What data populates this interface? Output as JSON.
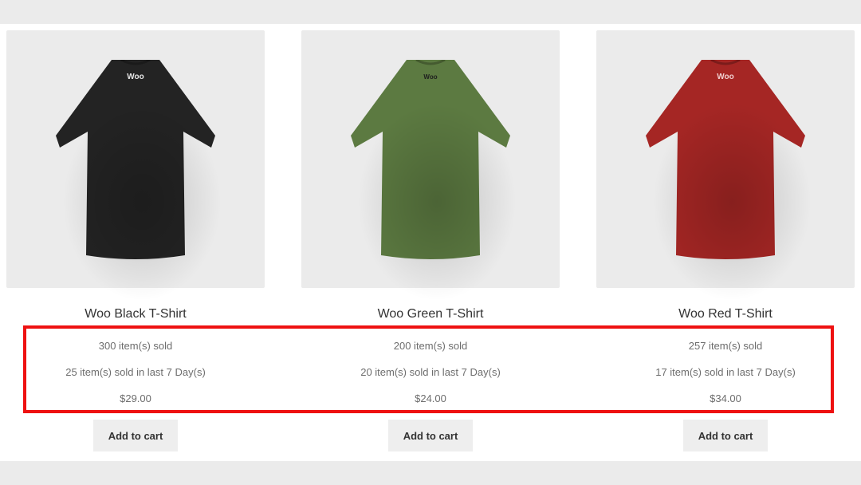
{
  "products": [
    {
      "title": "Woo Black T-Shirt",
      "sold_total": "300 item(s) sold",
      "sold_recent": "25 item(s) sold in last 7 Day(s)",
      "price": "$29.00",
      "cart_label": "Add to cart",
      "shirt_color": "#232323",
      "logo_text": "Woo"
    },
    {
      "title": "Woo Green T-Shirt",
      "sold_total": "200 item(s) sold",
      "sold_recent": "20 item(s) sold in last 7 Day(s)",
      "price": "$24.00",
      "cart_label": "Add to cart",
      "shirt_color": "#5c7a41",
      "logo_text": "Woo"
    },
    {
      "title": "Woo Red T-Shirt",
      "sold_total": "257 item(s) sold",
      "sold_recent": "17 item(s) sold in last 7 Day(s)",
      "price": "$34.00",
      "cart_label": "Add to cart",
      "shirt_color": "#a52624",
      "logo_text": "Woo"
    }
  ],
  "colors": {
    "highlight": "#ee1111",
    "page_bg": "#ebebeb",
    "card_bg": "#ebebeb",
    "button_bg": "#eeeeee"
  }
}
